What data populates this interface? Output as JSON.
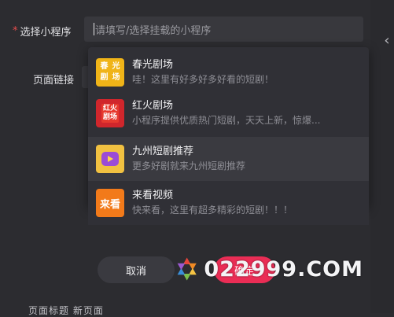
{
  "form": {
    "mini_program_label": "选择小程序",
    "required_mark": "*",
    "select_placeholder": "请填写/选择挂载的小程序",
    "page_link_label": "页面链接"
  },
  "dropdown": {
    "items": [
      {
        "title": "春光剧场",
        "desc": "哇！这里有好多好多好看的短剧！",
        "icon": "chunguang-icon",
        "icon_text": [
          "春",
          "光",
          "剧",
          "场"
        ]
      },
      {
        "title": "红火剧场",
        "desc": "小程序提供优质热门短剧，天天上新，惊爆...",
        "icon": "hongtuo-icon",
        "icon_text": [
          "红火",
          "剧场"
        ]
      },
      {
        "title": "九州短剧推荐",
        "desc": "更多好剧就来九州短剧推荐",
        "icon": "jiuzhou-play-icon"
      },
      {
        "title": "来看视频",
        "desc": "快来看，这里有超多精彩的短剧！！！",
        "icon": "laikan-icon",
        "icon_text": "来看"
      }
    ]
  },
  "buttons": {
    "cancel": "取消",
    "confirm": "确定"
  },
  "bottom_partial": "页面标题  新页面",
  "watermark": "022999.COM",
  "colors": {
    "accent": "#ea2d55",
    "background": "#2c2c30",
    "required": "#e84d4d"
  }
}
